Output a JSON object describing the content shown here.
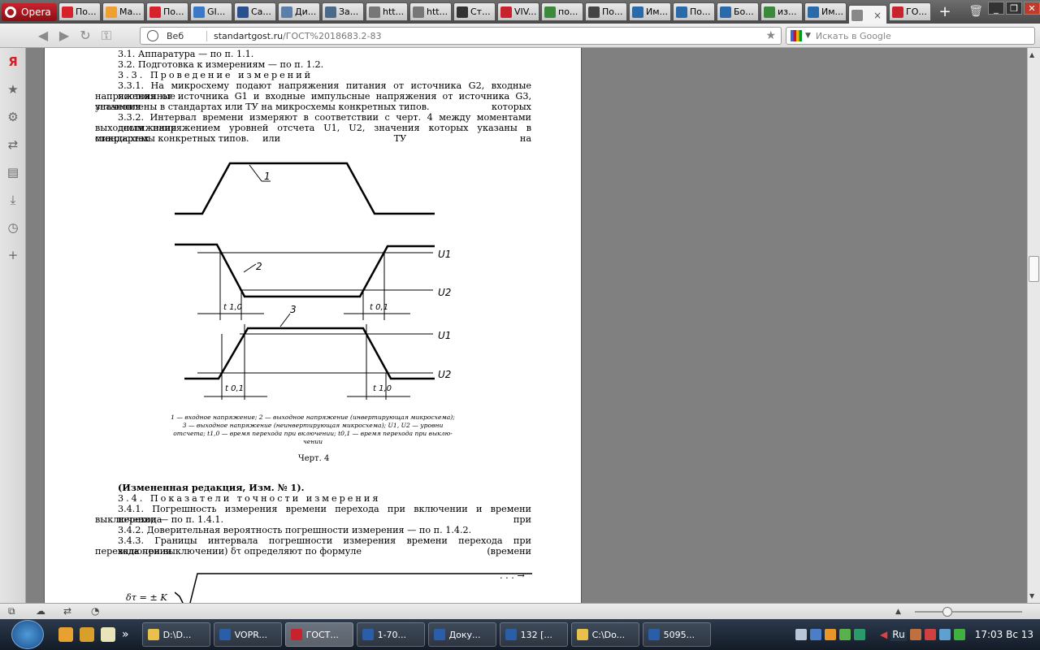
{
  "browser": {
    "menu_label": "Opera",
    "tabs": [
      {
        "label": "По...",
        "color": "#d5222b"
      },
      {
        "label": "Ма...",
        "color": "#f0a030"
      },
      {
        "label": "По...",
        "color": "#d5222b"
      },
      {
        "label": "GI...",
        "color": "#3a78c9"
      },
      {
        "label": "Са...",
        "color": "#2a5090"
      },
      {
        "label": "Ди...",
        "color": "#5a7fa8"
      },
      {
        "label": "За...",
        "color": "#4a6a8a"
      },
      {
        "label": "htt...",
        "color": "#777777"
      },
      {
        "label": "htt...",
        "color": "#777777"
      },
      {
        "label": "Ст...",
        "color": "#333333"
      },
      {
        "label": "VIV...",
        "color": "#c8232d"
      },
      {
        "label": "по...",
        "color": "#3b8a3b"
      },
      {
        "label": "По...",
        "color": "#444444"
      },
      {
        "label": "Им...",
        "color": "#2a6aa8"
      },
      {
        "label": "По...",
        "color": "#2a6aa8"
      },
      {
        "label": "Бо...",
        "color": "#2a6aa8"
      },
      {
        "label": "из...",
        "color": "#3b8a3b"
      },
      {
        "label": "Им...",
        "color": "#2a6aa8"
      },
      {
        "label": "",
        "color": "#888888",
        "active": true
      },
      {
        "label": "ГО...",
        "color": "#c8232d"
      }
    ],
    "address_label": "Веб",
    "url_host": "standartgost.ru",
    "url_path": "/ГОСТ%2018683.2-83",
    "search_placeholder": "Искать в Google"
  },
  "document": {
    "lines": [
      {
        "text": "3.1.  Аппаратура — по п. 1.1."
      },
      {
        "text": "3.2.  Подготовка к измерениям — по п. 1.2."
      },
      {
        "text": "3.3.  Проведение измерений"
      },
      {
        "text": "3.3.1. На микросхему подают напряжения питания от источника G2, входные постоянные"
      },
      {
        "text": "напряжения от источника G1 и входные импульсные напряжения от источника G3, значения которых"
      },
      {
        "text": "установлены в стандартах или ТУ на микросхемы конкретных типов."
      },
      {
        "text": "3.3.2. Интервал времени измеряют в соответствии с черт. 4 между моментами достижения"
      },
      {
        "text": "выходным напряжением уровней отсчета U1, U2, значения которых указаны в стандартах или ТУ на"
      },
      {
        "text": "микросхемы конкретных типов."
      }
    ],
    "figure": {
      "labels": {
        "l1": "1",
        "l2": "2",
        "l3": "3",
        "u1": "U1",
        "u2": "U2",
        "u1b": "U1",
        "u2b": "U2",
        "t10a": "t 1,0",
        "t01a": "t 0,1",
        "t01b": "t 0,1",
        "t10b": "t 1,0"
      },
      "caption_lines": [
        "1 — входное напряжение; 2 — выходное напряжение (инвертирующая микросхема);",
        "3 — выходное напряжение (неинвертирующая микросхема); U1, U2 — уровни",
        "отсчета; t1,0 — время перехода при включении; t0,1 — время перехода при выклю-",
        "чении"
      ],
      "title": "Черт. 4"
    },
    "after": [
      {
        "text": "(Измененная редакция, Изм. № 1)."
      },
      {
        "text": "3.4.  Показатели точности измерения"
      },
      {
        "text": "3.4.1. Погрешность измерения времени перехода при включении и времени перехода при"
      },
      {
        "text": "выключении — по п. 1.4.1."
      },
      {
        "text": "3.4.2.  Доверительная вероятность погрешности измерения — по п. 1.4.2."
      },
      {
        "text": "3.4.3. Границы интервала погрешности измерения времени перехода при включении (времени"
      },
      {
        "text": "перехода при выключении) δτ определяют по формуле"
      }
    ],
    "formula_left": "δτ = ± K",
    "formula_cont": ". . . →"
  },
  "sidebar": {
    "icons": [
      "yandex-icon",
      "bookmarks-icon",
      "settings-icon",
      "share-icon",
      "notes-icon",
      "downloads-icon",
      "history-icon",
      "add-panel-icon"
    ]
  },
  "taskbar": {
    "tasks": [
      {
        "label": "D:\\D...",
        "color": "#e8c04a"
      },
      {
        "label": "VOPR...",
        "color": "#2a5ea8"
      },
      {
        "label": "ГОСТ...",
        "color": "#c8232d",
        "active": true
      },
      {
        "label": "1-70...",
        "color": "#2a5ea8"
      },
      {
        "label": "Доку...",
        "color": "#2a5ea8"
      },
      {
        "label": "132 [...",
        "color": "#2a5ea8"
      },
      {
        "label": "C:\\Do...",
        "color": "#e8c04a"
      },
      {
        "label": "5095...",
        "color": "#2a5ea8"
      }
    ],
    "lang": "Ru",
    "clock": "17:03 Вс 13"
  }
}
